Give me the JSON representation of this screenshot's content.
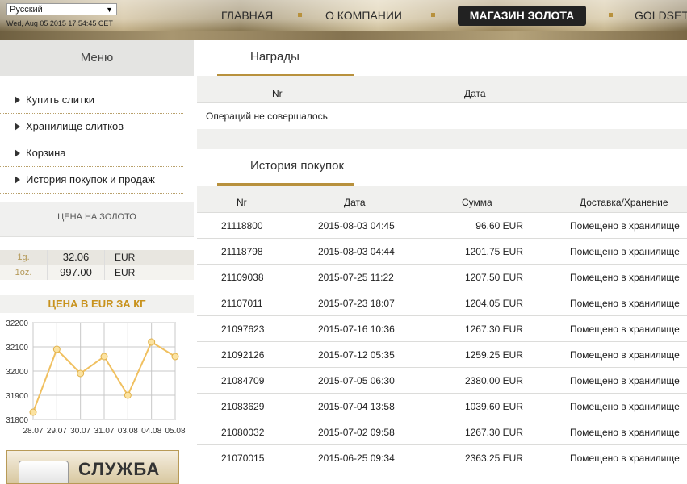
{
  "header": {
    "language": "Русский",
    "datetime": "Wed, Aug 05 2015 17:54:45 CET",
    "nav": {
      "home": "ГЛАВНАЯ",
      "about": "О КОМПАНИИ",
      "shop": "МАГАЗИН ЗОЛОТА",
      "goldset": "GOLDSET"
    }
  },
  "sidebar": {
    "menu_title": "Меню",
    "items": [
      {
        "label": "Купить слитки"
      },
      {
        "label": "Хранилище слитков"
      },
      {
        "label": "Корзина"
      },
      {
        "label": "История покупок и продаж"
      }
    ],
    "price_title": "ЦЕНА НА ЗОЛОТО",
    "prices": [
      {
        "unit": "1g.",
        "value": "32.06",
        "currency": "EUR"
      },
      {
        "unit": "1oz.",
        "value": "997.00",
        "currency": "EUR"
      }
    ],
    "chart_title": "ЦЕНА В EUR ЗА КГ",
    "service_text": "СЛУЖБА"
  },
  "chart_data": {
    "type": "line",
    "categories": [
      "28.07",
      "29.07",
      "30.07",
      "31.07",
      "03.08",
      "04.08",
      "05.08"
    ],
    "values": [
      31830,
      32090,
      31990,
      32060,
      31900,
      32120,
      32060
    ],
    "ylim": [
      31800,
      32200
    ],
    "yticks": [
      "32200",
      "32100",
      "32000",
      "31900",
      "31800"
    ],
    "grid": true,
    "line_color": "#f0c060"
  },
  "awards": {
    "tab_label": "Награды",
    "columns": [
      "Nr",
      "Дата"
    ],
    "empty_text": "Операций не совершалось"
  },
  "history": {
    "tab_label": "История покупок",
    "columns": [
      "Nr",
      "Дата",
      "Сумма",
      "Доставка/Хранение"
    ],
    "rows": [
      {
        "nr": "21118800",
        "date": "2015-08-03 04:45",
        "sum": "96.60 EUR",
        "delivery": "Помещено в хранилище"
      },
      {
        "nr": "21118798",
        "date": "2015-08-03 04:44",
        "sum": "1201.75 EUR",
        "delivery": "Помещено в хранилище"
      },
      {
        "nr": "21109038",
        "date": "2015-07-25 11:22",
        "sum": "1207.50 EUR",
        "delivery": "Помещено в хранилище"
      },
      {
        "nr": "21107011",
        "date": "2015-07-23 18:07",
        "sum": "1204.05 EUR",
        "delivery": "Помещено в хранилище"
      },
      {
        "nr": "21097623",
        "date": "2015-07-16 10:36",
        "sum": "1267.30 EUR",
        "delivery": "Помещено в хранилище"
      },
      {
        "nr": "21092126",
        "date": "2015-07-12 05:35",
        "sum": "1259.25 EUR",
        "delivery": "Помещено в хранилище"
      },
      {
        "nr": "21084709",
        "date": "2015-07-05 06:30",
        "sum": "2380.00 EUR",
        "delivery": "Помещено в хранилище"
      },
      {
        "nr": "21083629",
        "date": "2015-07-04 13:58",
        "sum": "1039.60 EUR",
        "delivery": "Помещено в хранилище"
      },
      {
        "nr": "21080032",
        "date": "2015-07-02 09:58",
        "sum": "1267.30 EUR",
        "delivery": "Помещено в хранилище"
      },
      {
        "nr": "21070015",
        "date": "2015-06-25 09:34",
        "sum": "2363.25 EUR",
        "delivery": "Помещено в хранилище"
      }
    ]
  }
}
